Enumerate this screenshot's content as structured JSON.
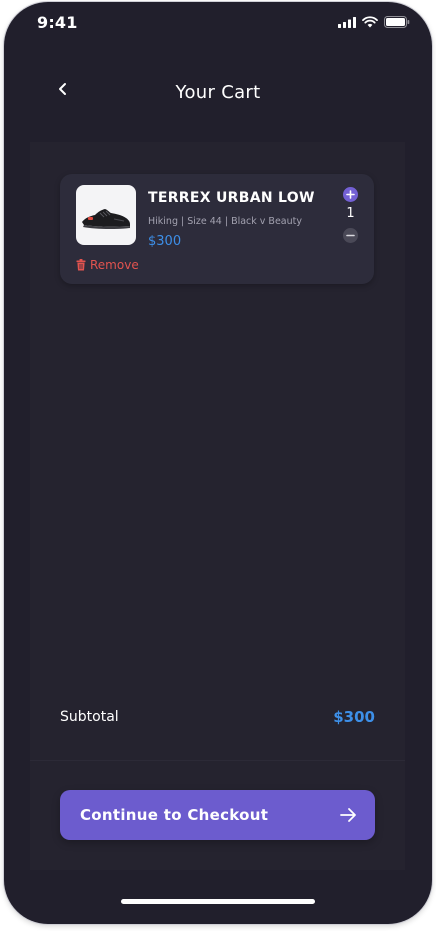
{
  "status_bar": {
    "time": "9:41",
    "icons": [
      "cellular-signal-icon",
      "wifi-icon",
      "battery-icon"
    ]
  },
  "header": {
    "title": "Your Cart",
    "back_icon": "chevron-left-icon"
  },
  "cart": {
    "items": [
      {
        "name": "TERREX URBAN LOW",
        "meta": "Hiking | Size 44 | Black v Beauty",
        "price": "$300",
        "quantity": "1",
        "remove_label": "Remove",
        "remove_icon": "trash-icon",
        "image_icon": "sneaker-icon"
      }
    ]
  },
  "summary": {
    "subtotal_label": "Subtotal",
    "subtotal_value": "$300"
  },
  "checkout": {
    "label": "Continue to Checkout",
    "icon": "arrow-right-icon"
  },
  "colors": {
    "background": "#211f2c",
    "panel": "#25232f",
    "card": "#2d2c3b",
    "accent": "#6c5cce",
    "price": "#3d8fe8",
    "danger": "#e2534f"
  }
}
